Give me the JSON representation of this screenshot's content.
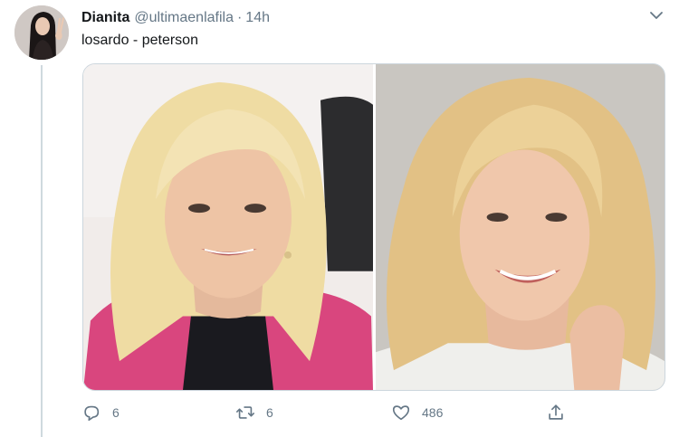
{
  "tweet": {
    "author": {
      "name": "Dianita",
      "handle": "@ultimaenlafila",
      "avatar_icon": "profile-photo"
    },
    "separator": "·",
    "time": "14h",
    "text": "losardo - peterson",
    "media": [
      {
        "icon": "photo-blonde-woman-pink-top"
      },
      {
        "icon": "photo-blonde-woman-smiling"
      }
    ],
    "actions": {
      "reply_count": "6",
      "retweet_count": "6",
      "like_count": "486",
      "share_count": ""
    },
    "colors": {
      "text": "#14171a",
      "secondary": "#657786",
      "border": "#ccd6dd",
      "thread_line": "#cfd9de"
    }
  }
}
